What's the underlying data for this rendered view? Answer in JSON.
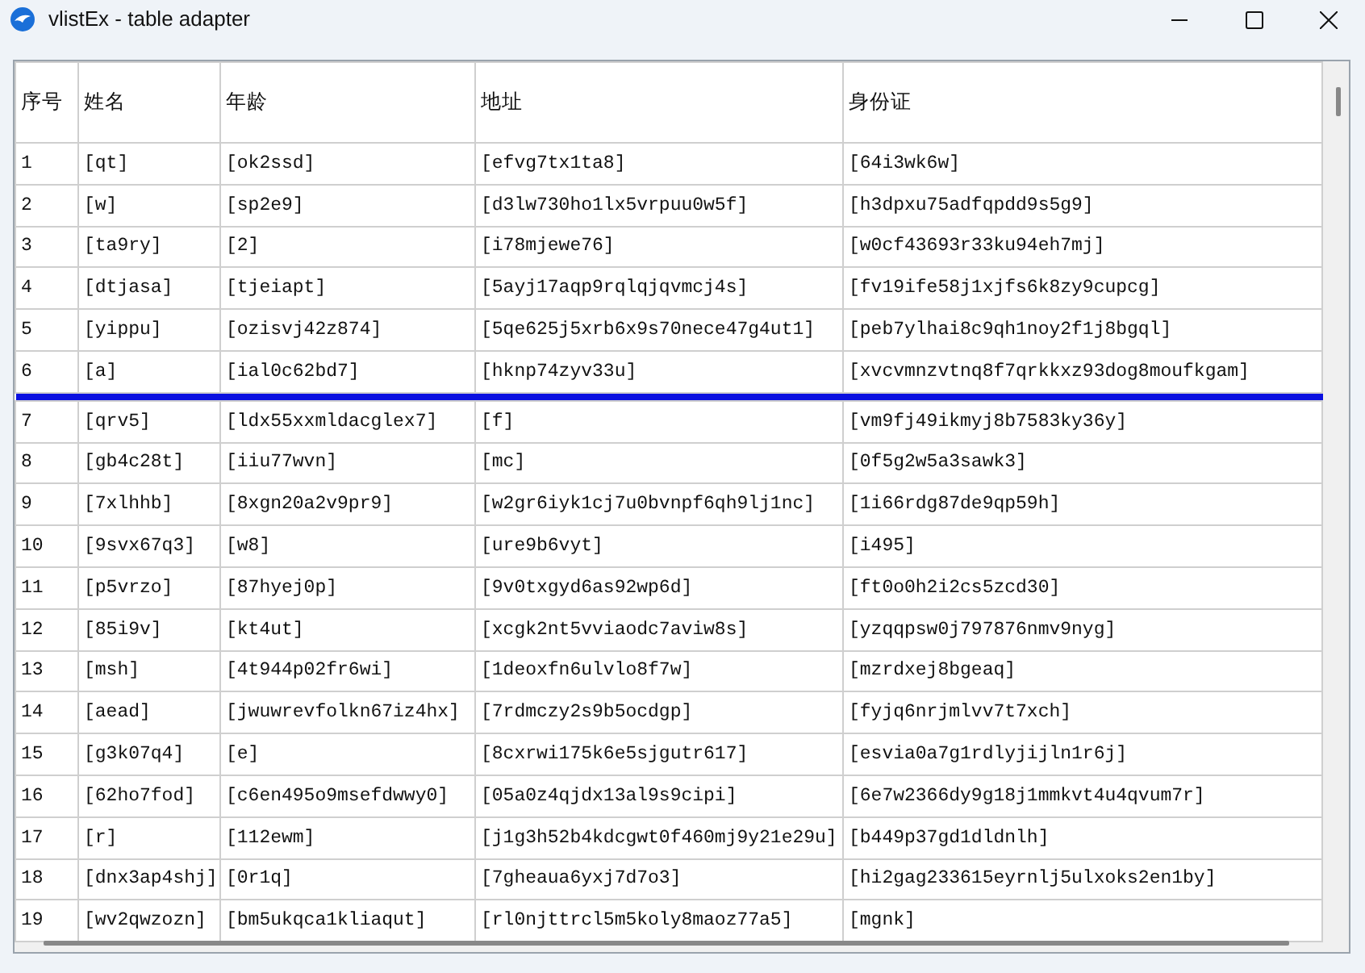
{
  "window": {
    "title": "vlistEx - table adapter"
  },
  "table": {
    "columns": [
      "序号",
      "姓名",
      "年龄",
      "地址",
      "身份证"
    ],
    "rows": [
      {
        "cells": [
          "1",
          "[qt]",
          "[ok2ssd]",
          "[efvg7tx1ta8]",
          "[64i3wk6w]"
        ],
        "selected": false
      },
      {
        "cells": [
          "2",
          "[w]",
          "[sp2e9]",
          "[d3lw730ho1lx5vrpuu0w5f]",
          "[h3dpxu75adfqpdd9s5g9]"
        ],
        "selected": false
      },
      {
        "cells": [
          "3",
          "[ta9ry]",
          "[2]",
          "[i78mjewe76]",
          "[w0cf43693r33ku94eh7mj]"
        ],
        "selected": false
      },
      {
        "cells": [
          "4",
          "[dtjasa]",
          "[tjeiapt]",
          "[5ayj17aqp9rqlqjqvmcj4s]",
          "[fv19ife58j1xjfs6k8zy9cupcg]"
        ],
        "selected": false
      },
      {
        "cells": [
          "5",
          "[yippu]",
          "[ozisvj42z874]",
          "[5qe625j5xrb6x9s70nece47g4ut1]",
          "[peb7ylhai8c9qh1noy2f1j8bgql]"
        ],
        "selected": false
      },
      {
        "cells": [
          "6",
          "[a]",
          "[ial0c62bd7]",
          "[hknp74zyv33u]",
          "[xvcvmnzvtnq8f7qrkkxz93dog8moufkgam]"
        ],
        "selected": true
      },
      {
        "cells": [
          "7",
          "[qrv5]",
          "[ldx55xxmldacglex7]",
          "[f]",
          "[vm9fj49ikmyj8b7583ky36y]"
        ],
        "selected": false
      },
      {
        "cells": [
          "8",
          "[gb4c28t]",
          "[iiu77wvn]",
          "[mc]",
          "[0f5g2w5a3sawk3]"
        ],
        "selected": false
      },
      {
        "cells": [
          "9",
          "[7xlhhb]",
          "[8xgn20a2v9pr9]",
          "[w2gr6iyk1cj7u0bvnpf6qh9lj1nc]",
          "[1i66rdg87de9qp59h]"
        ],
        "selected": false
      },
      {
        "cells": [
          "10",
          "[9svx67q3]",
          "[w8]",
          "[ure9b6vyt]",
          "[i495]"
        ],
        "selected": false
      },
      {
        "cells": [
          "11",
          "[p5vrzo]",
          "[87hyej0p]",
          "[9v0txgyd6as92wp6d]",
          "[ft0o0h2i2cs5zcd30]"
        ],
        "selected": false
      },
      {
        "cells": [
          "12",
          "[85i9v]",
          "[kt4ut]",
          "[xcgk2nt5vviaodc7aviw8s]",
          "[yzqqpsw0j797876nmv9nyg]"
        ],
        "selected": false
      },
      {
        "cells": [
          "13",
          "[msh]",
          "[4t944p02fr6wi]",
          "[1deoxfn6ulvlo8f7w]",
          "[mzrdxej8bgeaq]"
        ],
        "selected": false
      },
      {
        "cells": [
          "14",
          "[aead]",
          "[jwuwrevfolkn67iz4hx]",
          "[7rdmczy2s9b5ocdgp]",
          "[fyjq6nrjmlvv7t7xch]"
        ],
        "selected": false
      },
      {
        "cells": [
          "15",
          "[g3k07q4]",
          "[e]",
          "[8cxrwi175k6e5sjgutr617]",
          "[esvia0a7g1rdlyjijln1r6j]"
        ],
        "selected": false
      },
      {
        "cells": [
          "16",
          "[62ho7fod]",
          "[c6en495o9msefdwwy0]",
          "[05a0z4qjdx13al9s9cipi]",
          "[6e7w2366dy9g18j1mmkvt4u4qvum7r]"
        ],
        "selected": false
      },
      {
        "cells": [
          "17",
          "[r]",
          "[112ewm]",
          "[j1g3h52b4kdcgwt0f460mj9y21e29u]",
          "[b449p37gd1dldnlh]"
        ],
        "selected": false
      },
      {
        "cells": [
          "18",
          "[dnx3ap4shj]",
          "[0r1q]",
          "[7gheaua6yxj7d7o3]",
          "[hi2gag233615eyrnlj5ulxoks2en1by]"
        ],
        "selected": false
      },
      {
        "cells": [
          "19",
          "[wv2qwzozn]",
          "[bm5ukqca1kliaqut]",
          "[rl0njttrcl5m5koly8maoz77a5]",
          "[mgnk]"
        ],
        "selected": false
      }
    ]
  }
}
